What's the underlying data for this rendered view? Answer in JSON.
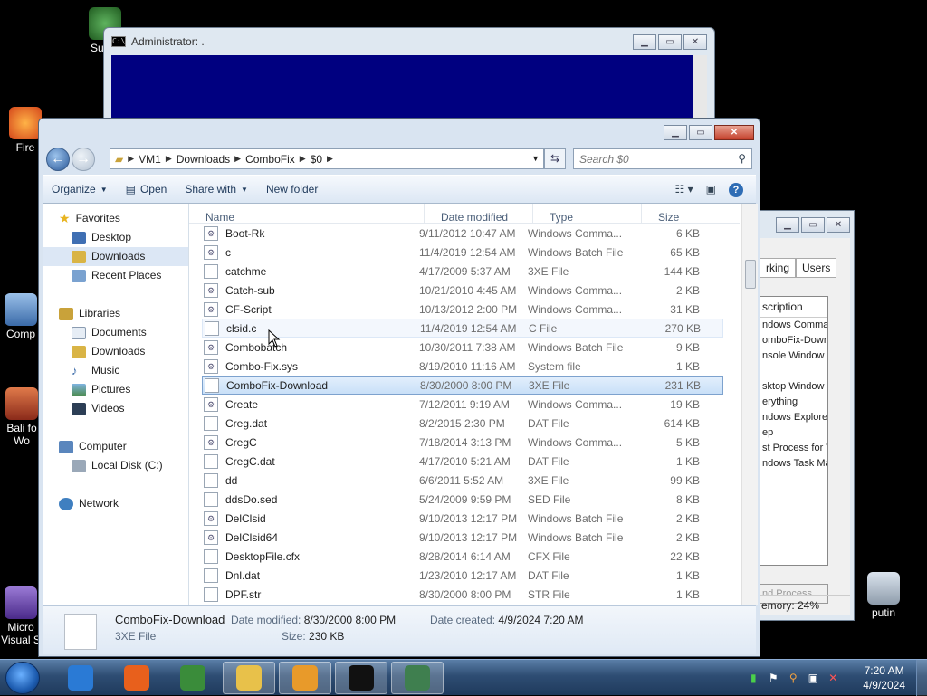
{
  "desktop": {
    "icons": [
      {
        "label": "Super",
        "color": "#3a8c3a"
      },
      {
        "label": "Fire",
        "color": "#e06020"
      },
      {
        "label": "Comp",
        "color": "#4a7fc0"
      },
      {
        "label": "Bali fo Wo",
        "color": "#c84a2a"
      },
      {
        "label": "Micro Visual S",
        "color": "#6a4ab0"
      },
      {
        "label": "putin",
        "color": "#9aa8b8"
      }
    ]
  },
  "cmd_window": {
    "title": "Administrator:  ."
  },
  "task_manager": {
    "tabs": [
      "rking",
      "Users"
    ],
    "column": "scription",
    "items": [
      "ndows Commar",
      "omboFix-Downlo",
      "nsole Window H",
      "",
      "sktop Window M",
      "erything",
      "ndows Explorer",
      "ep",
      "st Process for V",
      "ndows Task Ma"
    ],
    "end_process": "nd Process",
    "status": "emory: 24%"
  },
  "explorer": {
    "breadcrumb": [
      "VM1",
      "Downloads",
      "ComboFix",
      "$0"
    ],
    "search_placeholder": "Search $0",
    "toolbar": {
      "organize": "Organize",
      "open": "Open",
      "share_with": "Share with",
      "new_folder": "New folder"
    },
    "nav": {
      "favorites": "Favorites",
      "desktop": "Desktop",
      "downloads": "Downloads",
      "recent": "Recent Places",
      "libraries": "Libraries",
      "documents": "Documents",
      "lib_downloads": "Downloads",
      "music": "Music",
      "pictures": "Pictures",
      "videos": "Videos",
      "computer": "Computer",
      "local_disk": "Local Disk (C:)",
      "network": "Network"
    },
    "columns": {
      "name": "Name",
      "date": "Date modified",
      "type": "Type",
      "size": "Size"
    },
    "files": [
      {
        "name": "Boot-Rk",
        "date": "9/11/2012 10:47 AM",
        "type": "Windows Comma...",
        "size": "6 KB",
        "icon": "gear"
      },
      {
        "name": "c",
        "date": "11/4/2019 12:54 AM",
        "type": "Windows Batch File",
        "size": "65 KB",
        "icon": "gear"
      },
      {
        "name": "catchme",
        "date": "4/17/2009 5:37 AM",
        "type": "3XE File",
        "size": "144 KB",
        "icon": "blank"
      },
      {
        "name": "Catch-sub",
        "date": "10/21/2010 4:45 AM",
        "type": "Windows Comma...",
        "size": "2 KB",
        "icon": "gear"
      },
      {
        "name": "CF-Script",
        "date": "10/13/2012 2:00 PM",
        "type": "Windows Comma...",
        "size": "31 KB",
        "icon": "gear"
      },
      {
        "name": "clsid.c",
        "date": "11/4/2019 12:54 AM",
        "type": "C File",
        "size": "270 KB",
        "icon": "blank"
      },
      {
        "name": "Combobatch",
        "date": "10/30/2011 7:38 AM",
        "type": "Windows Batch File",
        "size": "9 KB",
        "icon": "gear"
      },
      {
        "name": "Combo-Fix.sys",
        "date": "8/19/2010 11:16 AM",
        "type": "System file",
        "size": "1 KB",
        "icon": "gear"
      },
      {
        "name": "ComboFix-Download",
        "date": "8/30/2000 8:00 PM",
        "type": "3XE File",
        "size": "231 KB",
        "icon": "blank"
      },
      {
        "name": "Create",
        "date": "7/12/2011 9:19 AM",
        "type": "Windows Comma...",
        "size": "19 KB",
        "icon": "gear"
      },
      {
        "name": "Creg.dat",
        "date": "8/2/2015 2:30 PM",
        "type": "DAT File",
        "size": "614 KB",
        "icon": "blank"
      },
      {
        "name": "CregC",
        "date": "7/18/2014 3:13 PM",
        "type": "Windows Comma...",
        "size": "5 KB",
        "icon": "gear"
      },
      {
        "name": "CregC.dat",
        "date": "4/17/2010 5:21 AM",
        "type": "DAT File",
        "size": "1 KB",
        "icon": "blank"
      },
      {
        "name": "dd",
        "date": "6/6/2011 5:52 AM",
        "type": "3XE File",
        "size": "99 KB",
        "icon": "blank"
      },
      {
        "name": "ddsDo.sed",
        "date": "5/24/2009 9:59 PM",
        "type": "SED File",
        "size": "8 KB",
        "icon": "blank"
      },
      {
        "name": "DelClsid",
        "date": "9/10/2013 12:17 PM",
        "type": "Windows Batch File",
        "size": "2 KB",
        "icon": "gear"
      },
      {
        "name": "DelClsid64",
        "date": "9/10/2013 12:17 PM",
        "type": "Windows Batch File",
        "size": "2 KB",
        "icon": "gear"
      },
      {
        "name": "DesktopFile.cfx",
        "date": "8/28/2014 6:14 AM",
        "type": "CFX File",
        "size": "22 KB",
        "icon": "blank"
      },
      {
        "name": "Dnl.dat",
        "date": "1/23/2010 12:17 AM",
        "type": "DAT File",
        "size": "1 KB",
        "icon": "blank"
      },
      {
        "name": "DPF.str",
        "date": "8/30/2000 8:00 PM",
        "type": "STR File",
        "size": "1 KB",
        "icon": "blank"
      }
    ],
    "hover_index": 5,
    "selected_index": 8,
    "details": {
      "name": "ComboFix-Download",
      "type": "3XE File",
      "modified_label": "Date modified:",
      "modified": "8/30/2000 8:00 PM",
      "created_label": "Date created:",
      "created": "4/9/2024 7:20 AM",
      "size_label": "Size:",
      "size": "230 KB"
    }
  },
  "taskbar": {
    "time": "7:20 AM",
    "date": "4/9/2024",
    "apps": [
      {
        "name": "internet-explorer",
        "color": "#2a7ad5"
      },
      {
        "name": "firefox",
        "color": "#e8601c"
      },
      {
        "name": "super",
        "color": "#3a8c3a"
      },
      {
        "name": "explorer",
        "color": "#e8c14a"
      },
      {
        "name": "media",
        "color": "#e89a2a"
      },
      {
        "name": "cmd",
        "color": "#111111"
      },
      {
        "name": "task-manager",
        "color": "#3f7f4f"
      }
    ]
  }
}
